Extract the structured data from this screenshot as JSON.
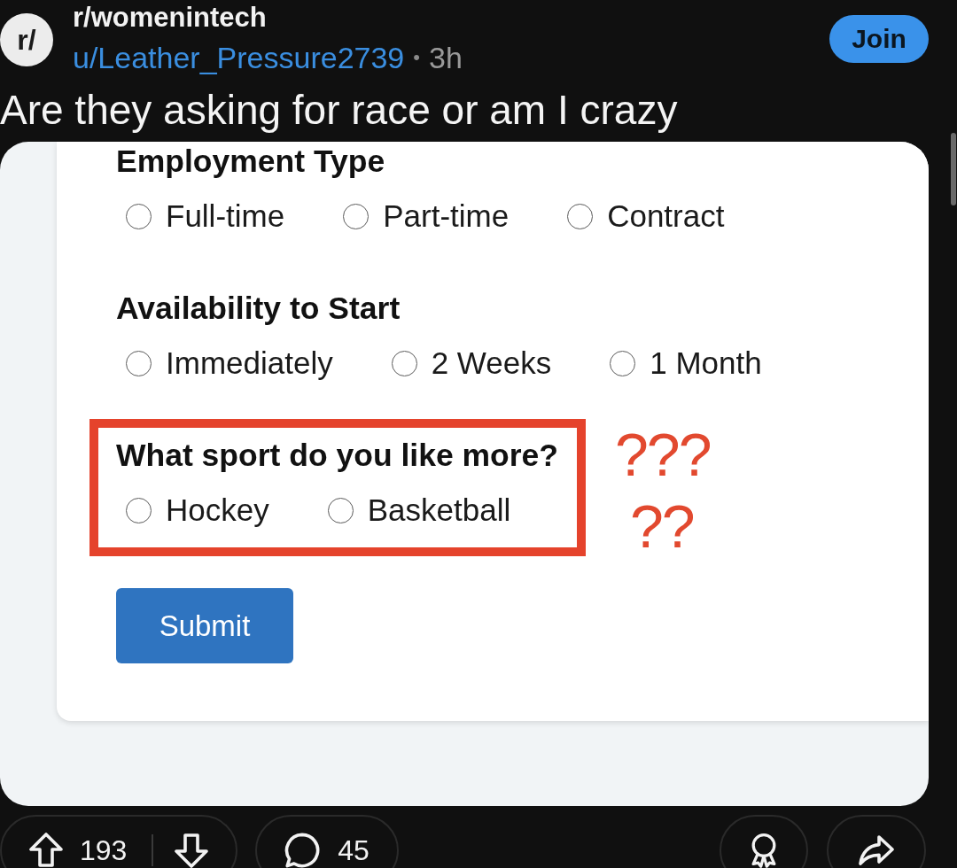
{
  "post": {
    "subreddit_icon": "r/",
    "subreddit": "r/womenintech",
    "author": "u/Leather_Pressure2739",
    "separator": "•",
    "age": "3h",
    "join_label": "Join",
    "title": "Are they asking for race or am I crazy"
  },
  "image": {
    "questions": [
      {
        "label": "Employment Type",
        "highlighted": false,
        "options": [
          {
            "label": "Full-time",
            "selected": false
          },
          {
            "label": "Part-time",
            "selected": false
          },
          {
            "label": "Contract",
            "selected": false
          }
        ]
      },
      {
        "label": "Availability to Start",
        "highlighted": false,
        "options": [
          {
            "label": "Immediately",
            "selected": false
          },
          {
            "label": "2 Weeks",
            "selected": false
          },
          {
            "label": "1 Month",
            "selected": false
          }
        ]
      },
      {
        "label": "What sport do you like more?",
        "highlighted": true,
        "options": [
          {
            "label": "Hockey",
            "selected": false
          },
          {
            "label": "Basketball",
            "selected": false
          }
        ],
        "annotations": [
          "???",
          "??"
        ]
      }
    ],
    "submit_label": "Submit"
  },
  "actions": {
    "score": "193",
    "comments": "45"
  }
}
